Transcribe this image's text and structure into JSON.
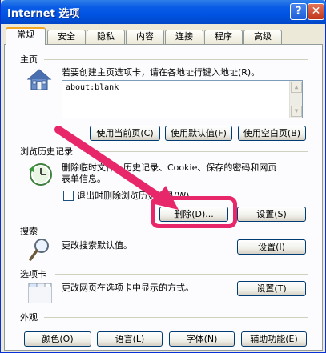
{
  "window": {
    "title": "Internet 选项",
    "help_label": "?",
    "close_label": "✕"
  },
  "tabs": [
    "常规",
    "安全",
    "隐私",
    "内容",
    "连接",
    "程序",
    "高级"
  ],
  "home": {
    "section_title": "主页",
    "description": "若要创建主页选项卡，请在各地址行键入地址(R)。",
    "url_value": "about:blank",
    "buttons": {
      "use_current": "使用当前页(C)",
      "use_default": "使用默认值(F)",
      "use_blank": "使用空白页(B)"
    }
  },
  "history": {
    "section_title": "浏览历史记录",
    "description_line1": "删除临时文件、历史记录、Cookie、保存的密码和网页",
    "description_line2": "表单信息。",
    "checkbox_label": "退出时删除浏览历史记录(W)",
    "checkbox_checked": false,
    "delete_button": "删除(D)...",
    "settings_button": "设置(S)"
  },
  "search": {
    "section_title": "搜索",
    "description": "更改搜索默认值。",
    "settings_button": "设置(I)"
  },
  "tabs_section": {
    "section_title": "选项卡",
    "description": "更改网页在选项卡中显示的方式。",
    "settings_button": "设置(T)"
  },
  "appearance": {
    "section_title": "外观",
    "buttons": {
      "colors": "颜色(O)",
      "languages": "语言(L)",
      "fonts": "字体(N)",
      "accessibility": "辅助功能(E)"
    }
  },
  "annotation": {
    "highlight_color": "#e8276a"
  }
}
